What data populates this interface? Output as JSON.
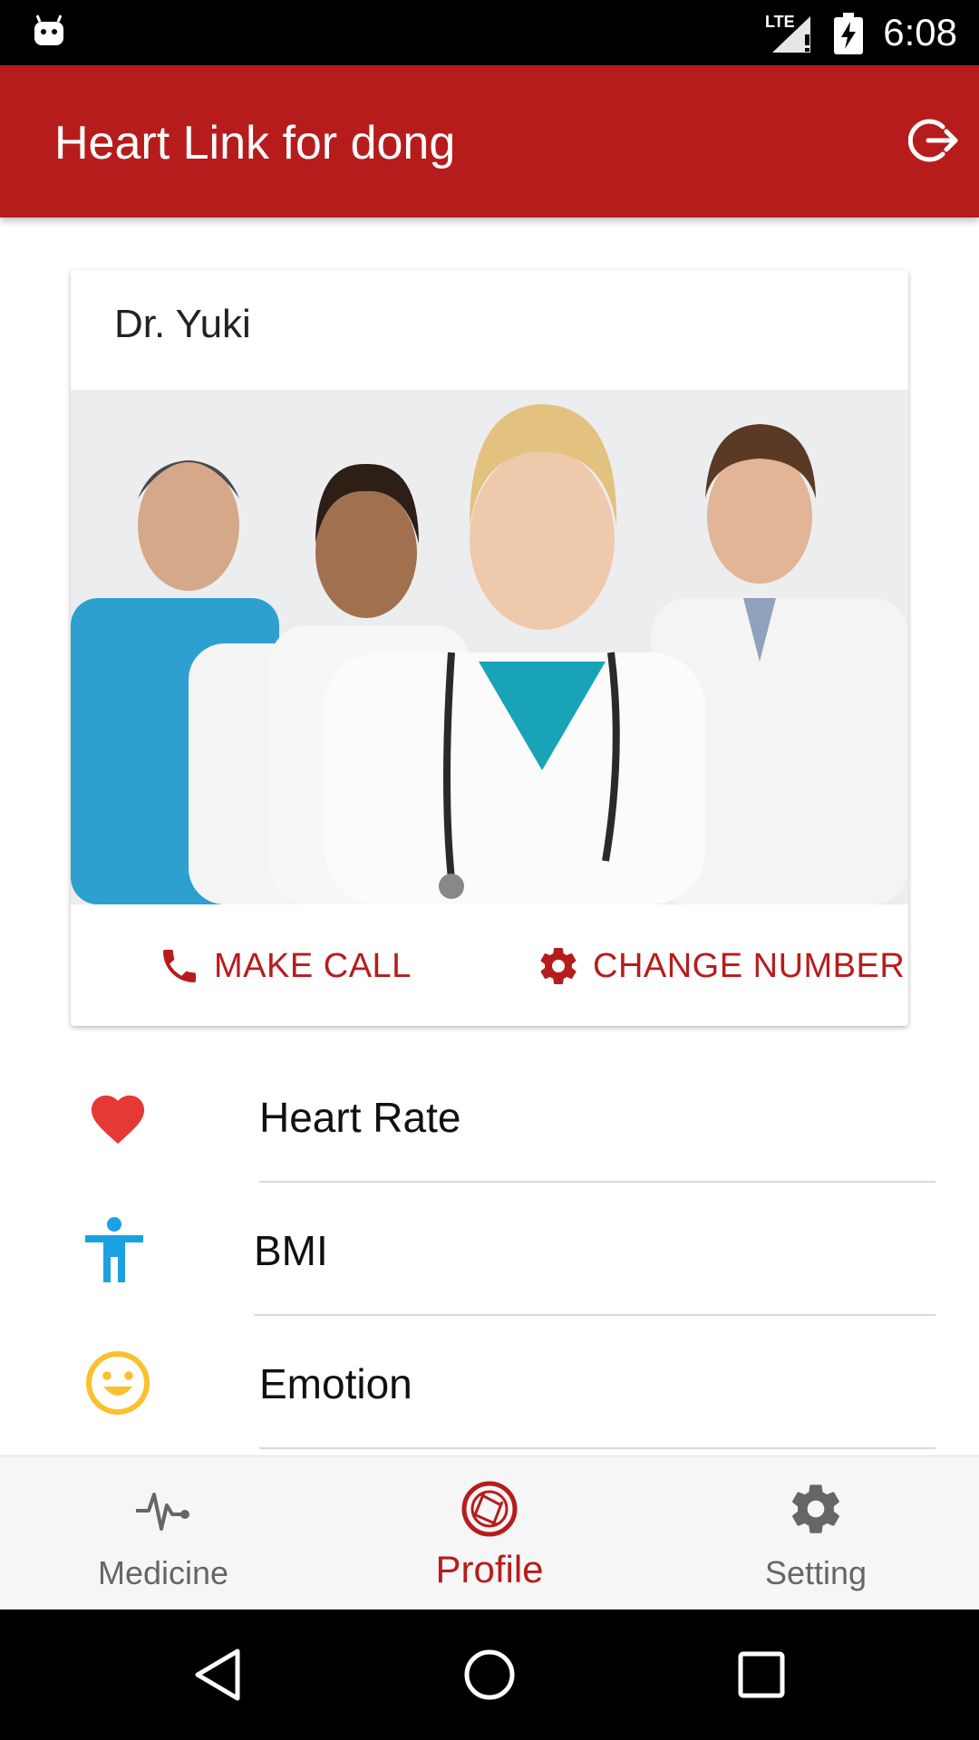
{
  "status_bar": {
    "time": "6:08",
    "network": "LTE"
  },
  "app_bar": {
    "title": "Heart Link for dong"
  },
  "doctor_card": {
    "name": "Dr. Yuki",
    "make_call_label": "MAKE CALL",
    "change_number_label": "CHANGE NUMBER"
  },
  "metrics": [
    {
      "label": "Heart Rate",
      "icon": "heart-icon",
      "color": "#e53935"
    },
    {
      "label": "BMI",
      "icon": "person-icon",
      "color": "#1ba1e2"
    },
    {
      "label": "Emotion",
      "icon": "smiley-icon",
      "color": "#fbc02d"
    }
  ],
  "bottom_nav": [
    {
      "label": "Medicine",
      "icon": "pulse-icon",
      "active": false
    },
    {
      "label": "Profile",
      "icon": "aperture-icon",
      "active": true
    },
    {
      "label": "Setting",
      "icon": "gear-icon",
      "active": false
    }
  ],
  "colors": {
    "primary": "#b71c1c",
    "accent_red": "#e53935",
    "accent_blue": "#1ba1e2",
    "accent_yellow": "#fbc02d"
  }
}
